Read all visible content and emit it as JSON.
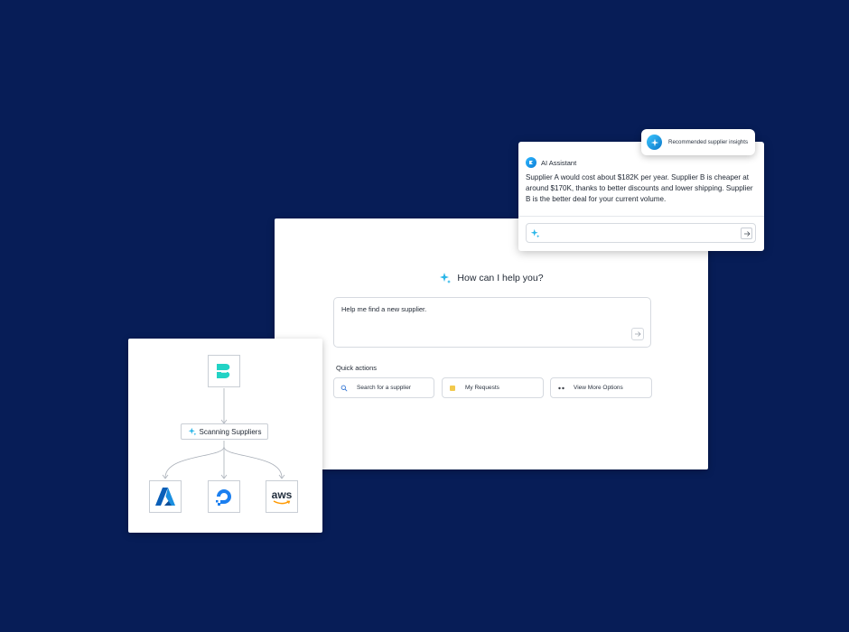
{
  "assistant": {
    "heading": "How can I help you?",
    "prompt_value": "Help me find a new supplier.",
    "quick_actions_title": "Quick actions",
    "quick_actions": [
      {
        "label": "Search for a supplier",
        "icon": "search-icon"
      },
      {
        "label": "My Requests",
        "icon": "folder-icon"
      },
      {
        "label": "View More Options",
        "icon": "more-icon"
      }
    ]
  },
  "ai_card": {
    "title": "AI Assistant",
    "message": "Supplier A would cost about $182K per year. Supplier B is cheaper at around $170K, thanks to better discounts and lower shipping. Supplier B is the better deal for your current volume.",
    "input_placeholder": ""
  },
  "insights_pill": {
    "label": "Recommended supplier insights"
  },
  "scan_card": {
    "label": "Scanning Suppliers",
    "providers": [
      {
        "name": "azure-logo"
      },
      {
        "name": "digitalocean-logo"
      },
      {
        "name": "aws-logo",
        "text": "aws"
      }
    ]
  },
  "colors": {
    "background": "#071d57",
    "accent": "#16b8e6",
    "brand_teal": "#22d3c5"
  }
}
